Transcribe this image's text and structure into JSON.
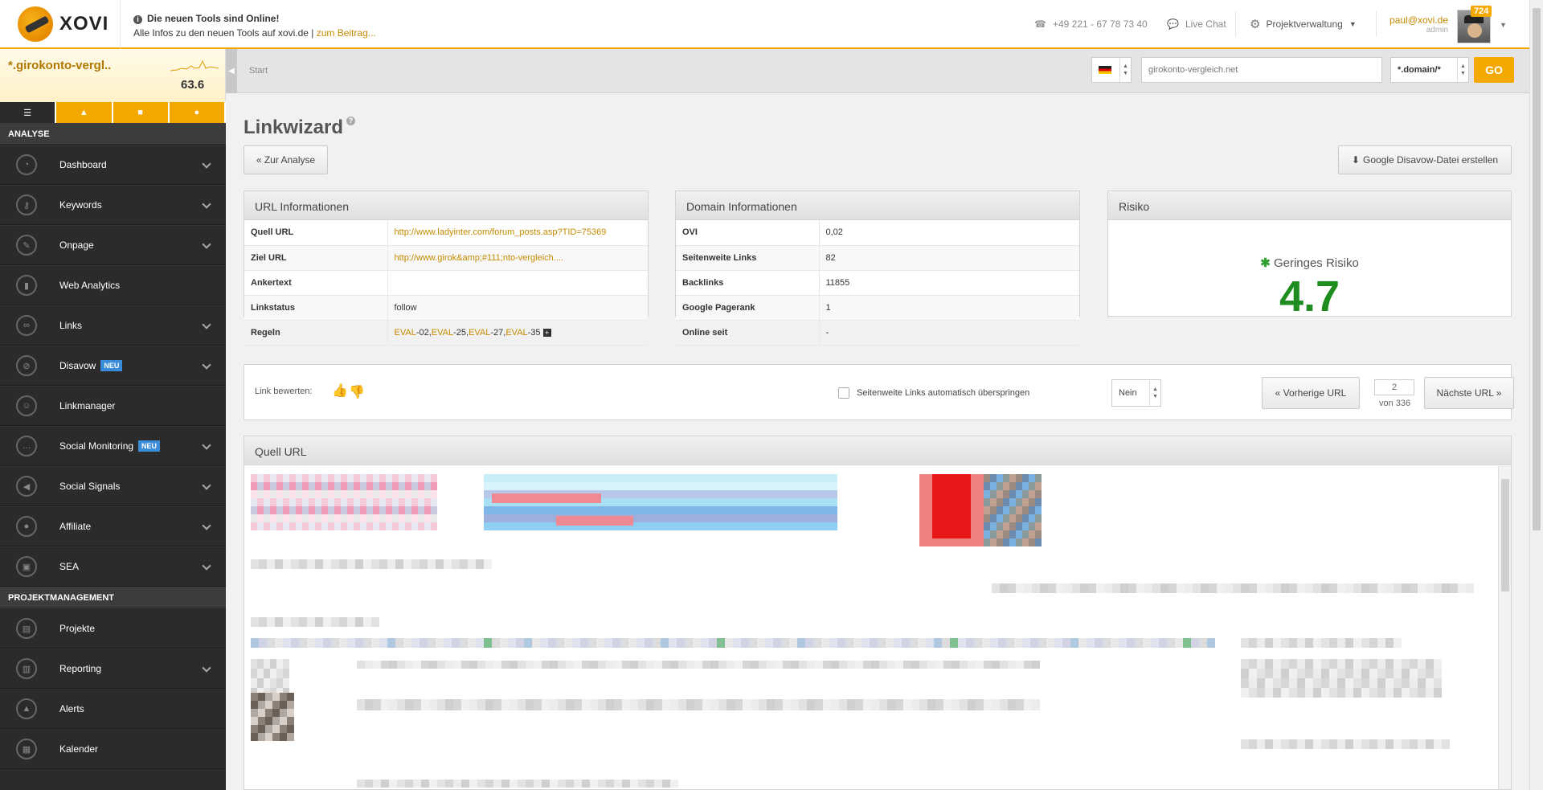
{
  "header": {
    "logo": "XOVI",
    "news_title": "Die neuen Tools sind Online!",
    "news_text": "Alle Infos zu den neuen Tools auf xovi.de |",
    "news_link": "zum Beitrag...",
    "phone": "+49 221 - 67 78 73 40",
    "live_chat": "Live Chat",
    "project_menu": "Projektverwaltung",
    "user_email": "paul@xovi.de",
    "user_role": "admin",
    "notification_count": "724"
  },
  "sidebar": {
    "project_name": "*.girokonto-vergl..",
    "project_score": "63.6",
    "sections": [
      {
        "title": "ANALYSE",
        "items": [
          {
            "label": "Dashboard",
            "icon": "dashboard-icon",
            "expandable": true
          },
          {
            "label": "Keywords",
            "icon": "key-icon",
            "expandable": true
          },
          {
            "label": "Onpage",
            "icon": "wrench-icon",
            "expandable": true
          },
          {
            "label": "Web Analytics",
            "icon": "bar-chart-icon",
            "expandable": false
          },
          {
            "label": "Links",
            "icon": "link-icon",
            "expandable": true
          },
          {
            "label": "Disavow",
            "icon": "disavow-icon",
            "expandable": true,
            "badge": "NEU"
          },
          {
            "label": "Linkmanager",
            "icon": "users-icon",
            "expandable": false
          },
          {
            "label": "Social Monitoring",
            "icon": "chat-icon",
            "expandable": true,
            "badge": "NEU"
          },
          {
            "label": "Social Signals",
            "icon": "megaphone-icon",
            "expandable": true
          },
          {
            "label": "Affiliate",
            "icon": "people-icon",
            "expandable": true
          },
          {
            "label": "SEA",
            "icon": "sea-icon",
            "expandable": true
          }
        ]
      },
      {
        "title": "PROJEKTMANAGEMENT",
        "items": [
          {
            "label": "Projekte",
            "icon": "project-icon",
            "expandable": false
          },
          {
            "label": "Reporting",
            "icon": "report-icon",
            "expandable": true
          },
          {
            "label": "Alerts",
            "icon": "alert-icon",
            "expandable": false
          },
          {
            "label": "Kalender",
            "icon": "calendar-icon",
            "expandable": false
          }
        ]
      }
    ]
  },
  "toolbar": {
    "breadcrumb": "Start",
    "domain_value": "girokonto-vergleich.net",
    "scope_value": "*.domain/*",
    "go_label": "GO"
  },
  "page": {
    "title": "Linkwizard",
    "back_button": "« Zur Analyse",
    "disavow_button": "Google Disavow-Datei erstellen"
  },
  "url_info": {
    "title": "URL Informationen",
    "rows": [
      {
        "key": "Quell URL",
        "value": "http://www.ladyinter.com/forum_posts.asp?TID=75369",
        "link": true
      },
      {
        "key": "Ziel URL",
        "value": "http://www.girok&amp;#111;nto-vergleich....",
        "link": true
      },
      {
        "key": "Ankertext",
        "value": ""
      },
      {
        "key": "Linkstatus",
        "value": "follow"
      },
      {
        "key": "Regeln",
        "value": "EVAL-02,EVAL-25,EVAL-27,EVAL-35"
      }
    ]
  },
  "domain_info": {
    "title": "Domain Informationen",
    "rows": [
      {
        "key": "OVI",
        "value": "0,02"
      },
      {
        "key": "Seitenweite Links",
        "value": "82"
      },
      {
        "key": "Backlinks",
        "value": "11855"
      },
      {
        "key": "Google Pagerank",
        "value": "1"
      },
      {
        "key": "Online seit",
        "value": "-"
      }
    ]
  },
  "risk": {
    "title": "Risiko",
    "label": "Geringes Risiko",
    "value": "4.7",
    "color": "#1e8c1e"
  },
  "rating": {
    "label": "Link bewerten:",
    "skip_label": "Seitenweite Links automatisch überspringen",
    "skip_value": "Nein",
    "prev_button": "« Vorherige URL",
    "next_button": "Nächste URL »",
    "current_page": "2",
    "total_pages": "von 336"
  },
  "preview": {
    "title": "Quell URL"
  },
  "colors": {
    "accent": "#f5a800",
    "sidebar": "#2b2b2b",
    "link": "#c58a00"
  }
}
